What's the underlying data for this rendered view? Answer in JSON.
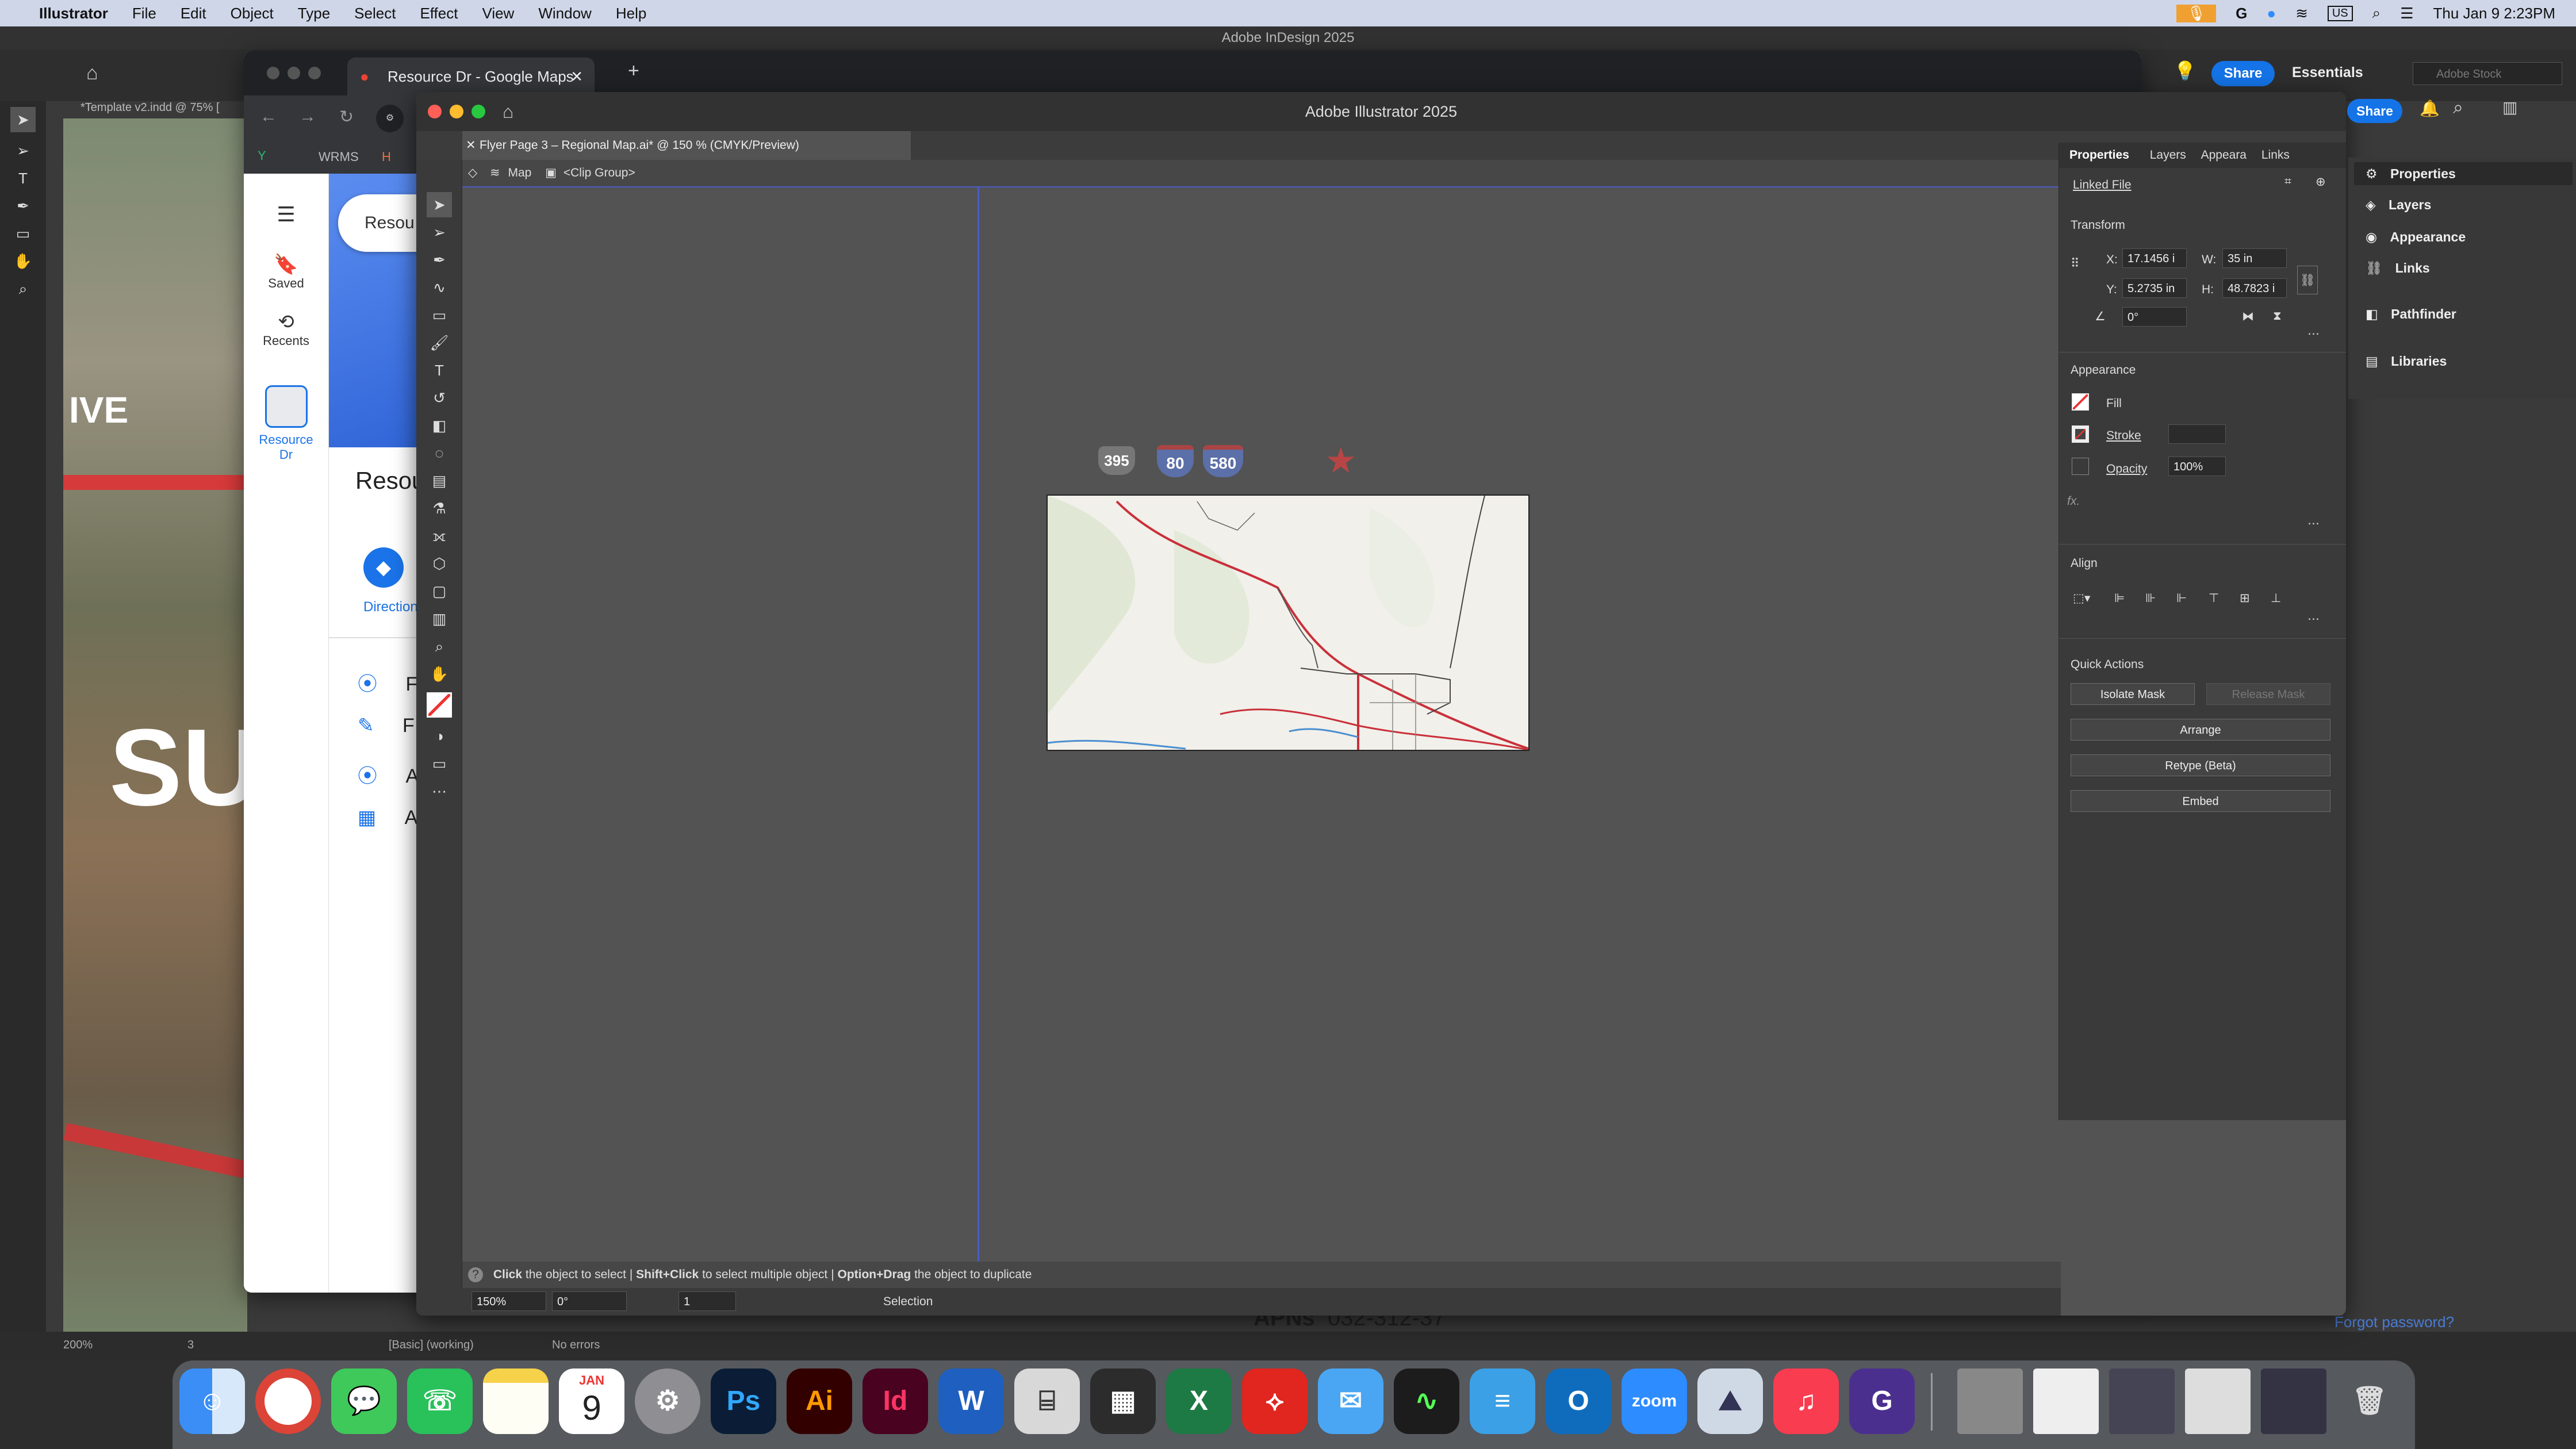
{
  "menubar": {
    "app_name": "Illustrator",
    "items": [
      "File",
      "Edit",
      "Object",
      "Type",
      "Select",
      "Effect",
      "View",
      "Window",
      "Help"
    ],
    "input_source": "US",
    "datetime": "Thu Jan 9  2:23PM"
  },
  "indesign": {
    "window_title": "Adobe InDesign 2025",
    "doc_tab": "*Template v2.indd @ 75% [",
    "share_label": "Share",
    "workspace_label": "Essentials",
    "stock_placeholder": "Adobe Stock",
    "page_text_1": "IVE",
    "page_text_2": "SU",
    "page_text_3": "APNs",
    "page_text_4": "032-312-37",
    "forgot_password": "Forgot password?",
    "zoom": "200%",
    "page_number": "3",
    "style": "[Basic] (working)",
    "errors": "No errors"
  },
  "chrome": {
    "tab_title": "Resource Dr - Google Maps",
    "bookmarks": [
      "WRMS",
      "H"
    ],
    "search_value": "Resou",
    "sidebar": {
      "saved": "Saved",
      "recents": "Recents",
      "place_label": "Resource Dr"
    },
    "panel_title": "Resou",
    "directions_label": "Direction",
    "list_items": [
      "F",
      "F",
      "A",
      "A"
    ]
  },
  "illustrator": {
    "window_title": "Adobe Illustrator 2025",
    "share_label": "Share",
    "doc_tab": "Flyer Page 3 – Regional Map.ai* @ 150 % (CMYK/Preview)",
    "breadcrumb": {
      "layer": "Map",
      "group": "<Clip Group>"
    },
    "map_badges": [
      "395",
      "80",
      "580"
    ],
    "message": {
      "p1_bold": "Click",
      "p1": " the object to select  |  ",
      "p2_bold": "Shift+Click",
      "p2": " to select multiple object  |  ",
      "p3_bold": "Option+Drag",
      "p3": " the object to duplicate"
    },
    "status": {
      "zoom": "150%",
      "rotate": "0°",
      "artboard": "1",
      "tool": "Selection"
    },
    "properties": {
      "tabs": [
        "Properties",
        "Layers",
        "Appeara",
        "Links"
      ],
      "linked_file": "Linked File",
      "transform_title": "Transform",
      "x_label": "X:",
      "x_value": "17.1456 i",
      "y_label": "Y:",
      "y_value": "5.2735 in",
      "w_label": "W:",
      "w_value": "35 in",
      "h_label": "H:",
      "h_value": "48.7823 i",
      "angle_value": "0°",
      "appearance_title": "Appearance",
      "fill_label": "Fill",
      "stroke_label": "Stroke",
      "opacity_label": "Opacity",
      "opacity_value": "100%",
      "fx_label": "fx.",
      "align_title": "Align",
      "quick_actions_title": "Quick Actions",
      "isolate_mask": "Isolate Mask",
      "release_mask": "Release Mask",
      "arrange": "Arrange",
      "retype": "Retype (Beta)",
      "embed": "Embed"
    }
  },
  "right_panels": [
    "Properties",
    "Layers",
    "Appearance",
    "Links",
    "Pathfinder",
    "Libraries"
  ],
  "dock": {
    "calendar_month": "JAN",
    "calendar_day": "9",
    "apps": [
      "Finder",
      "Chrome",
      "Messages",
      "WhatsApp",
      "Notes",
      "Calendar",
      "System Settings",
      "Photoshop",
      "Illustrator",
      "InDesign",
      "Word",
      "Screenshot",
      "Calculator",
      "Excel",
      "Acrobat",
      "Mail",
      "Activity Monitor",
      "Mailspring",
      "Outlook",
      "Zoom",
      "Preview",
      "Music",
      "Grammarly",
      "Trash"
    ],
    "labels": {
      "ps": "Ps",
      "ai": "Ai",
      "id": "Id",
      "word": "W",
      "excel": "X",
      "zoom": "zoom"
    }
  }
}
